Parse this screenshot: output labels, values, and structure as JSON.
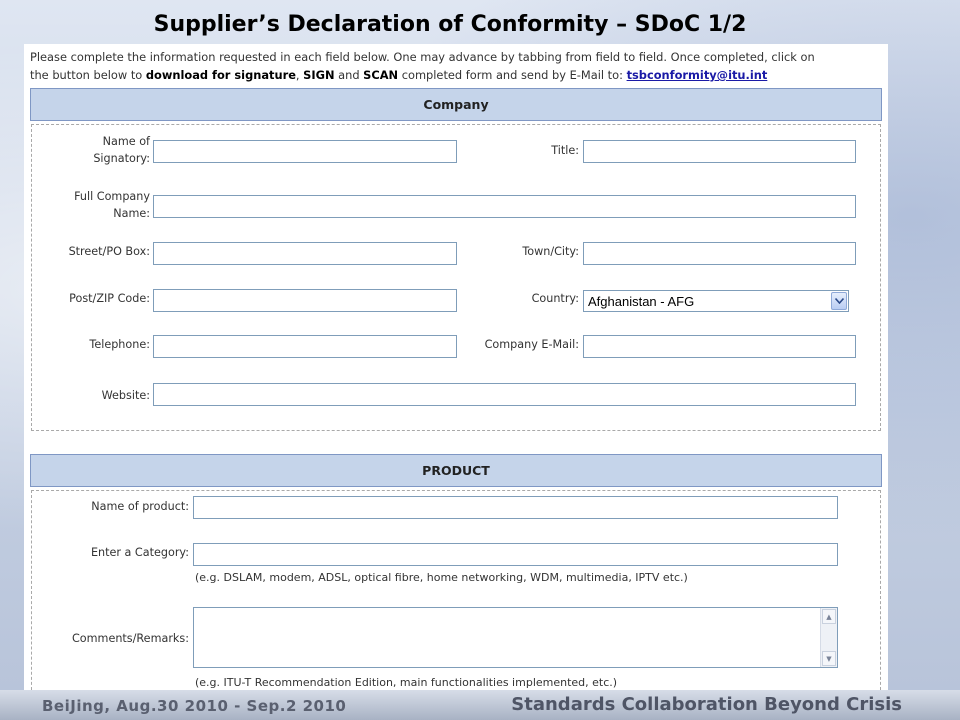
{
  "slide": {
    "title": "Supplier’s Declaration of Conformity – SDoC 1/2",
    "footer_left": "BeiJing,   Aug.30 2010 - Sep.2  2010",
    "footer_right": "Standards Collaboration Beyond Crisis"
  },
  "intro": {
    "line1": "Please complete the information requested in each field below. One may advance by tabbing from field to field. Once completed, click on",
    "line2_prefix": "the button below to ",
    "line2_b1": "download for signature",
    "line2_sep1": ", ",
    "line2_b2": "SIGN",
    "line2_sep2": " and ",
    "line2_b3": "SCAN",
    "line2_suffix": " completed form and send by E-Mail to: ",
    "email": "tsbconformity@itu.int"
  },
  "company": {
    "header": "Company",
    "signatory_l1": "Name of",
    "signatory_l2": "Signatory:",
    "title": "Title:",
    "company_l1": "Full Company",
    "company_l2": "Name:",
    "street": "Street/PO Box:",
    "town": "Town/City:",
    "zip": "Post/ZIP Code:",
    "country": "Country:",
    "country_value": "Afghanistan - AFG",
    "telephone": "Telephone:",
    "email": "Company E-Mail:",
    "website": "Website:"
  },
  "product": {
    "header": "PRODUCT",
    "name": "Name of product:",
    "category": "Enter a Category:",
    "category_hint": "(e.g. DSLAM, modem, ADSL, optical fibre, home networking, WDM, multimedia, IPTV etc.)",
    "comments": "Comments/Remarks:",
    "comments_hint": "(e.g. ITU-T Recommendation Edition, main functionalities implemented, etc.)"
  },
  "icons": {
    "dropdown": "chevron-down-icon",
    "scroll_up": "scroll-up-icon",
    "scroll_down": "scroll-down-icon"
  },
  "colors": {
    "section_header_bg": "#c5d4ea",
    "link": "#1a1aa6",
    "input_border": "#7f9db9"
  }
}
